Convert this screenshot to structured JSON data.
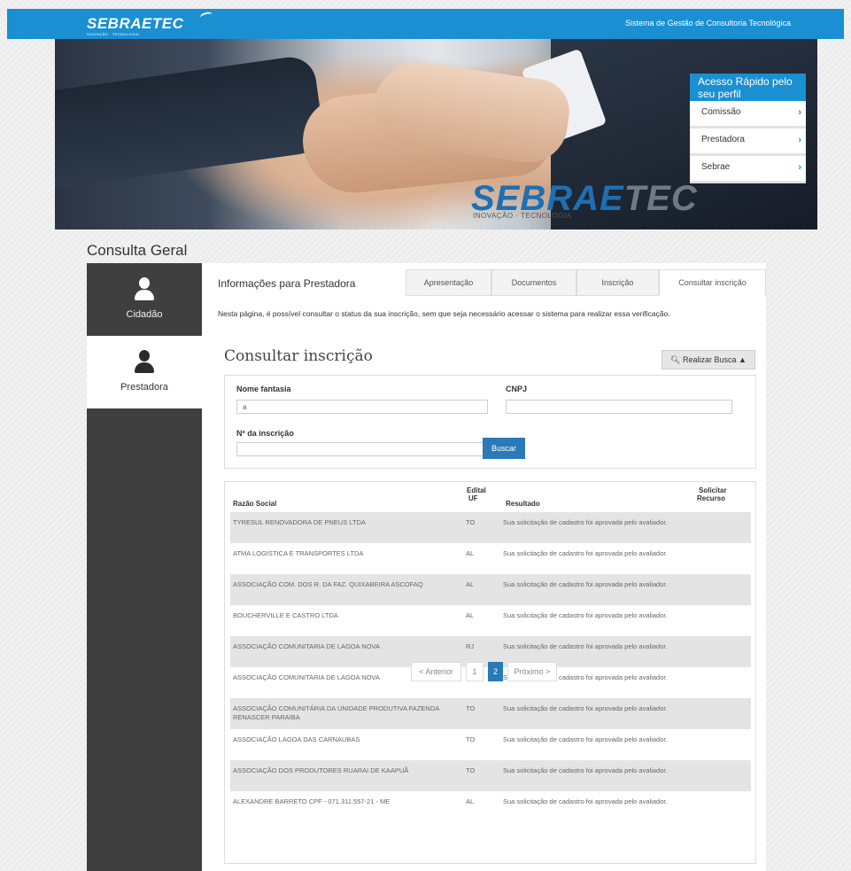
{
  "header": {
    "brand": "SEBRAETEC",
    "brand_tagline": "INOVAÇÃO · TECNOLOGIA",
    "system_title": "Sistema de Gestão de Consultoria Tecnológica"
  },
  "banner": {
    "brand_main": "SEBRAE",
    "brand_faded": "TEC",
    "tagline": "INOVAÇÃO · TECNOLOGIA"
  },
  "quick_access": {
    "title": "Acesso Rápido pelo seu perfil",
    "items": [
      {
        "label": "Comissão",
        "icon": "chevron-right-icon"
      },
      {
        "label": "Prestadora",
        "icon": "chevron-right-icon"
      },
      {
        "label": "Sebrae",
        "icon": "chevron-right-icon"
      }
    ]
  },
  "page": {
    "title": "Consulta Geral"
  },
  "sidebar": {
    "items": [
      {
        "label": "Cidadão",
        "icon": "person-icon",
        "active": false
      },
      {
        "label": "Prestadora",
        "icon": "person-icon",
        "active": true
      }
    ]
  },
  "main": {
    "section_heading": "Informações para Prestadora",
    "tabs": [
      {
        "label": "Apresentação",
        "active": false
      },
      {
        "label": "Documentos",
        "active": false
      },
      {
        "label": "Inscrição",
        "active": false
      },
      {
        "label": "Consultar inscrição",
        "active": true
      }
    ],
    "intro": "Nesta página, é possível consultar o status da sua inscrição, sem que seja necessário acessar o sistema para realizar essa verificação.",
    "consult_title": "Consultar inscrição",
    "search_toggle": "Realizar Busca ▲",
    "form": {
      "nome_fantasia_label": "Nome fantasia",
      "nome_fantasia_value": "a",
      "cnpj_label": "CNPJ",
      "cnpj_value": "",
      "inscricao_label": "Nº da inscrição",
      "inscricao_value": "",
      "submit_label": "Buscar"
    },
    "table": {
      "headers": {
        "razao": "Razão Social",
        "edital_line1": "Edital",
        "edital_line2": "UF",
        "resultado": "Resultado",
        "recurso_line1": "Solicitar",
        "recurso_line2": "Recurso"
      },
      "rows": [
        {
          "razao": "TYRESUL RENOVADORA DE PNEUS LTDA",
          "uf": "TO",
          "resultado": "Sua solicitação de cadastro foi aprovada pelo avaliador."
        },
        {
          "razao": "ATMA LOGISTICA E TRANSPORTES LTDA",
          "uf": "AL",
          "resultado": "Sua solicitação de cadastro foi aprovada pelo avaliador."
        },
        {
          "razao": "ASSOCIAÇÃO COM. DOS R. DA FAZ. QUIXABEIRA ASCOFAQ",
          "uf": "AL",
          "resultado": "Sua solicitação de cadastro foi aprovada pelo avaliador."
        },
        {
          "razao": "BOUCHERVILLE E CASTRO LTDA",
          "uf": "AL",
          "resultado": "Sua solicitação de cadastro foi aprovada pelo avaliador."
        },
        {
          "razao": "ASSOCIAÇÃO COMUNITARIA DE LAGOA NOVA",
          "uf": "RJ",
          "resultado": "Sua solicitação de cadastro foi aprovada pelo avaliador."
        },
        {
          "razao": "ASSOCIAÇÃO COMUNITARIA DE LAGOA NOVA",
          "uf": "TO",
          "resultado": "Sua solicitação de cadastro foi aprovada pelo avaliador."
        },
        {
          "razao": "ASSOCIAÇÃO COMUNITÁRIA DA UNIDADE PRODUTIVA FAZENDA RENASCER PARAIBA",
          "uf": "TO",
          "resultado": "Sua solicitação de cadastro foi aprovada pelo avaliador."
        },
        {
          "razao": "ASSOCIAÇÃO LAGOA DAS CARNAUBAS",
          "uf": "TO",
          "resultado": "Sua solicitação de cadastro foi aprovada pelo avaliador."
        },
        {
          "razao": "ASSOCIAÇÃO DOS PRODUTORES RUARAI DE KAAPUÃ",
          "uf": "TO",
          "resultado": "Sua solicitação de cadastro foi aprovada pelo avaliador."
        },
        {
          "razao": "ALEXANDRE BARRETO CPF - 071.311.557-21 - ME",
          "uf": "AL",
          "resultado": "Sua solicitação de cadastro foi aprovada pelo avaliador."
        }
      ]
    },
    "pagination": {
      "prev": "< Anterior",
      "pages": [
        "1",
        "2"
      ],
      "current": "2",
      "next": "Próximo >"
    }
  },
  "colors": {
    "brand_blue": "#1a8fd2",
    "button_blue": "#2a7ab8",
    "sidebar_dark": "#3f3f3f",
    "row_shade": "#e4e4e4"
  }
}
